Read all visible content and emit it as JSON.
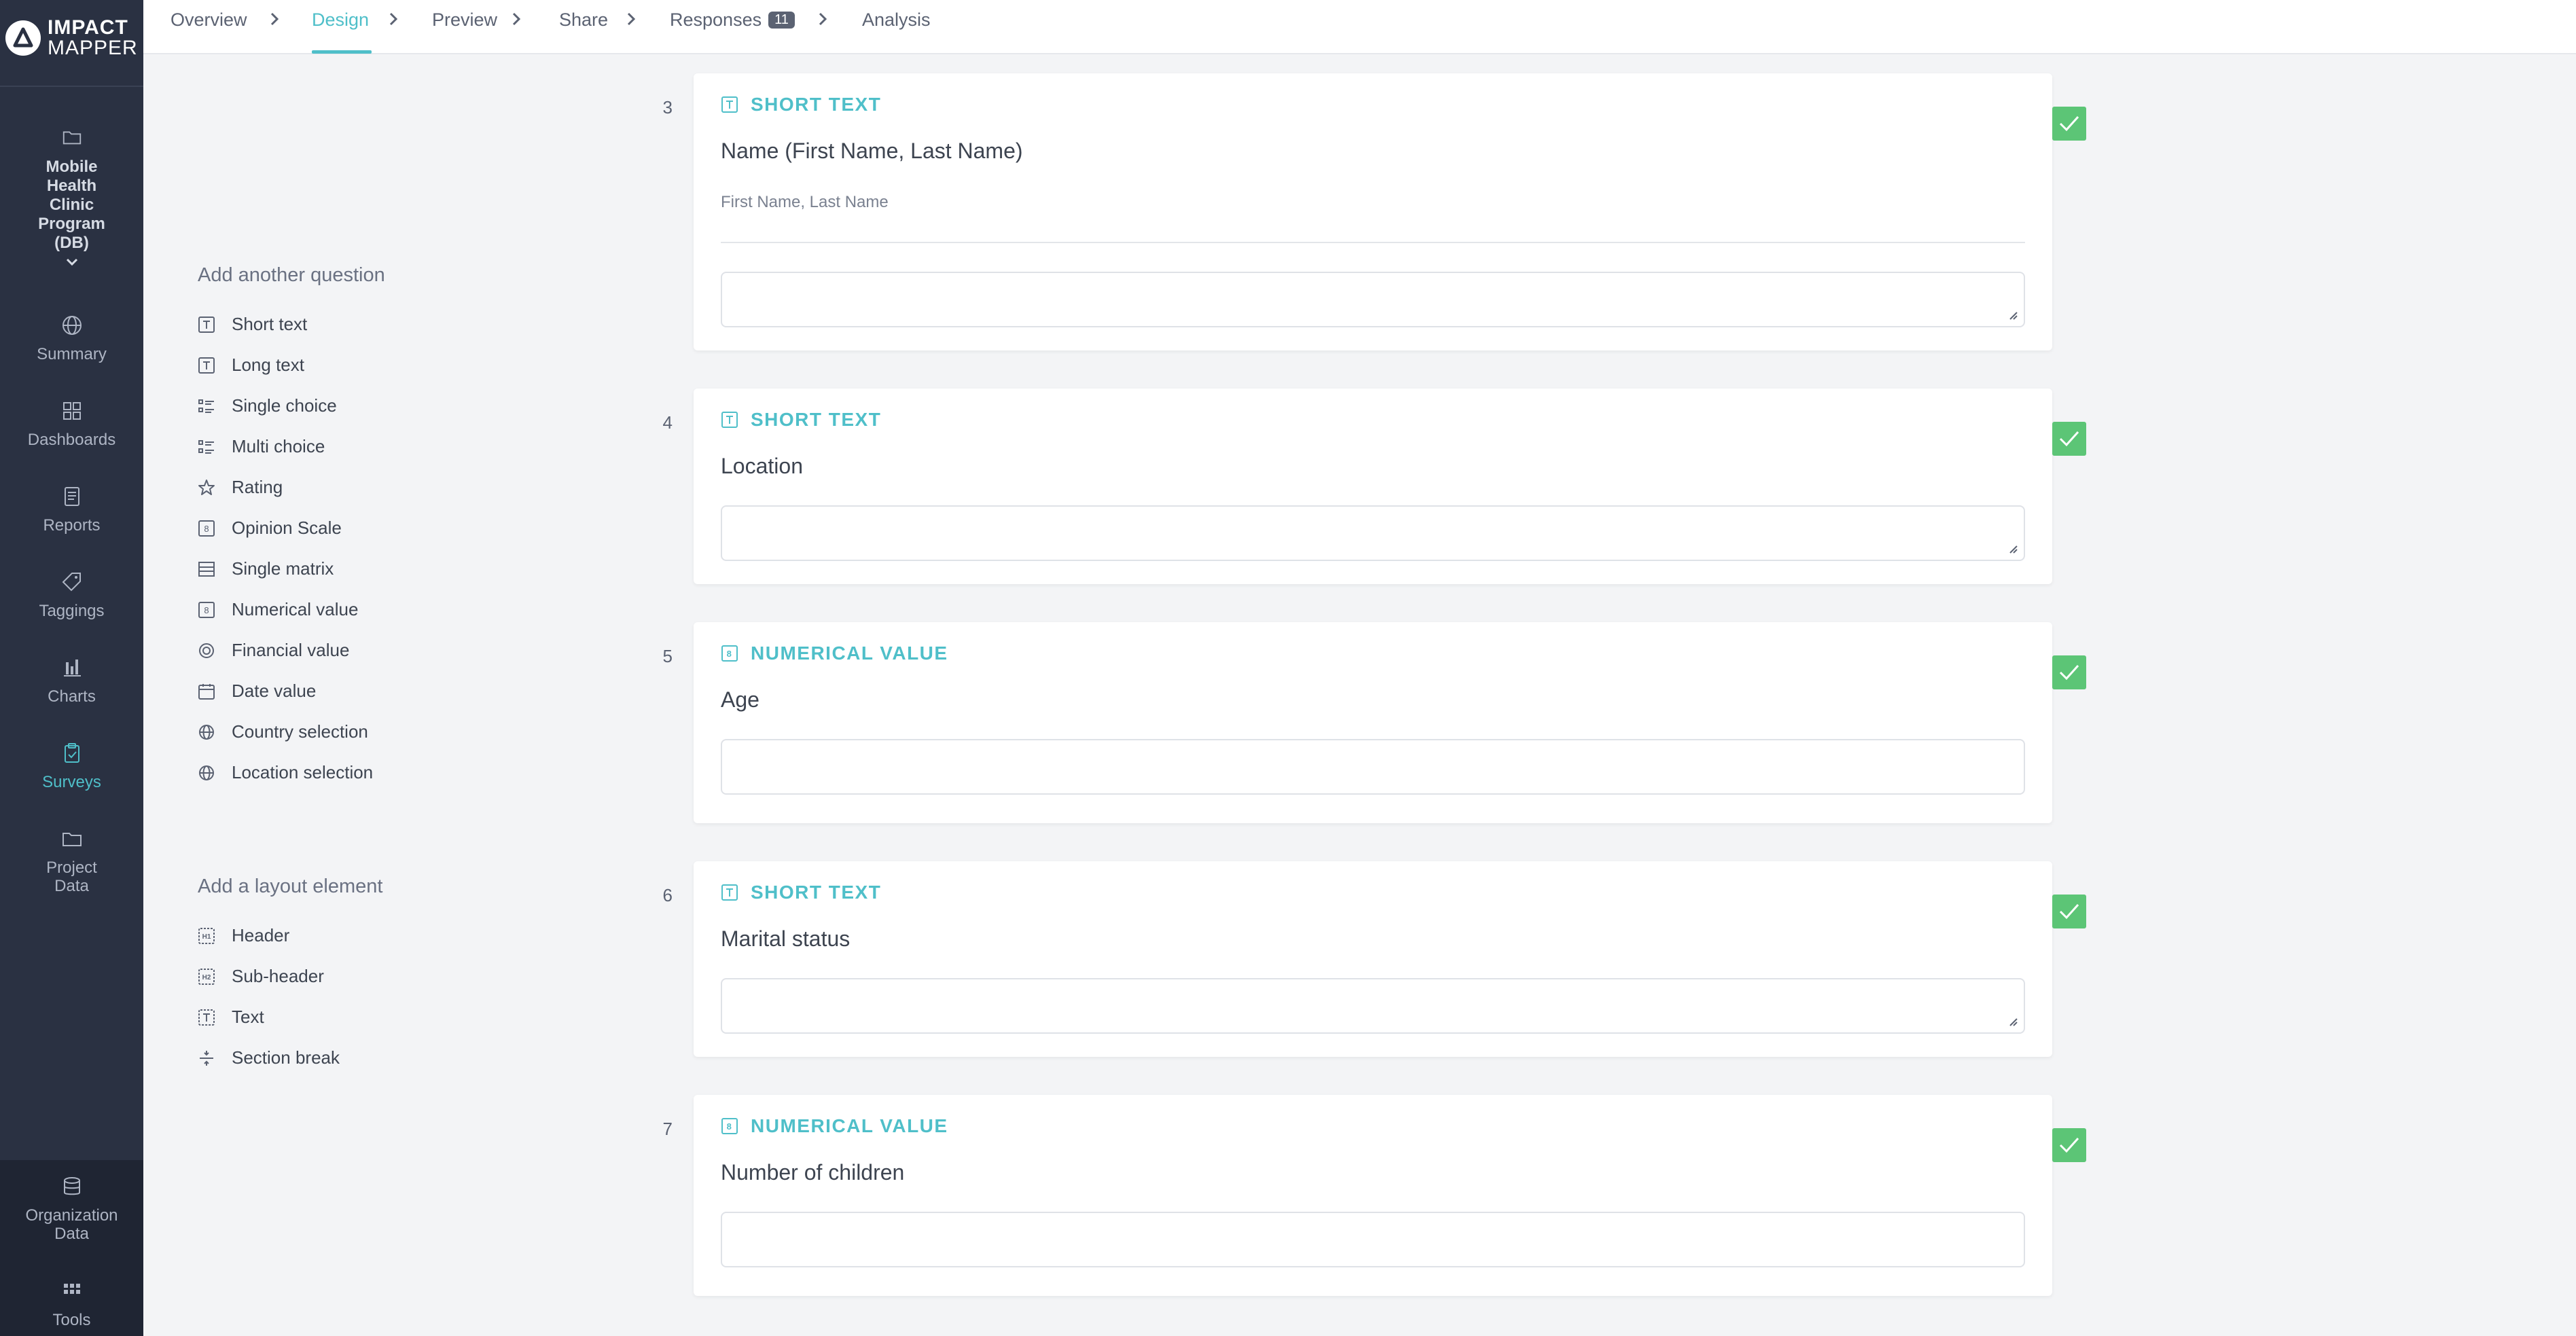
{
  "brand": {
    "line1": "IMPACT",
    "line2": "MAPPER"
  },
  "sidebar": {
    "project": {
      "label": "Mobile Health Clinic Program (DB)"
    },
    "items": [
      {
        "label": "Summary",
        "icon": "globe-icon"
      },
      {
        "label": "Dashboards",
        "icon": "grid-icon"
      },
      {
        "label": "Reports",
        "icon": "report-icon"
      },
      {
        "label": "Taggings",
        "icon": "tag-icon"
      },
      {
        "label": "Charts",
        "icon": "bar-chart-icon"
      },
      {
        "label": "Surveys",
        "icon": "clipboard-check-icon",
        "active": true
      },
      {
        "label": "Project Data",
        "icon": "folder-icon"
      }
    ],
    "bottom": [
      {
        "label": "Organization Data",
        "icon": "database-icon"
      },
      {
        "label": "Tools",
        "icon": "apps-icon"
      }
    ]
  },
  "nav": {
    "tabs": [
      {
        "label": "Overview"
      },
      {
        "label": "Design",
        "active": true
      },
      {
        "label": "Preview"
      },
      {
        "label": "Share"
      },
      {
        "label": "Responses",
        "badge": "11"
      },
      {
        "label": "Analysis"
      }
    ]
  },
  "palette": {
    "questions_title": "Add another question",
    "questions": [
      {
        "label": "Short text",
        "icon": "text-box-icon"
      },
      {
        "label": "Long text",
        "icon": "text-box-icon"
      },
      {
        "label": "Single choice",
        "icon": "list-icon"
      },
      {
        "label": "Multi choice",
        "icon": "list-icon"
      },
      {
        "label": "Rating",
        "icon": "star-icon"
      },
      {
        "label": "Opinion Scale",
        "icon": "number-box-icon"
      },
      {
        "label": "Single matrix",
        "icon": "matrix-icon"
      },
      {
        "label": "Numerical value",
        "icon": "number-box-icon"
      },
      {
        "label": "Financial value",
        "icon": "coin-icon"
      },
      {
        "label": "Date value",
        "icon": "calendar-icon"
      },
      {
        "label": "Country selection",
        "icon": "globe-icon"
      },
      {
        "label": "Location selection",
        "icon": "globe-icon"
      }
    ],
    "layout_title": "Add a layout element",
    "layout": [
      {
        "label": "Header",
        "icon": "h1-icon"
      },
      {
        "label": "Sub-header",
        "icon": "h2-icon"
      },
      {
        "label": "Text",
        "icon": "text-box-icon"
      },
      {
        "label": "Section break",
        "icon": "section-break-icon"
      }
    ]
  },
  "questions": [
    {
      "number": "3",
      "type": "SHORT TEXT",
      "label": "Name (First Name, Last Name)",
      "placeholder": "First Name, Last Name",
      "checked": true
    },
    {
      "number": "4",
      "type": "SHORT TEXT",
      "label": "Location",
      "checked": true
    },
    {
      "number": "5",
      "type": "NUMERICAL VALUE",
      "label": "Age",
      "checked": true
    },
    {
      "number": "6",
      "type": "SHORT TEXT",
      "label": "Marital status",
      "checked": true
    },
    {
      "number": "7",
      "type": "NUMERICAL VALUE",
      "label": "Number of children",
      "checked": true
    }
  ],
  "colors": {
    "accent": "#4fbfc9",
    "sidebar": "#2a3142",
    "check": "#5cc576"
  }
}
